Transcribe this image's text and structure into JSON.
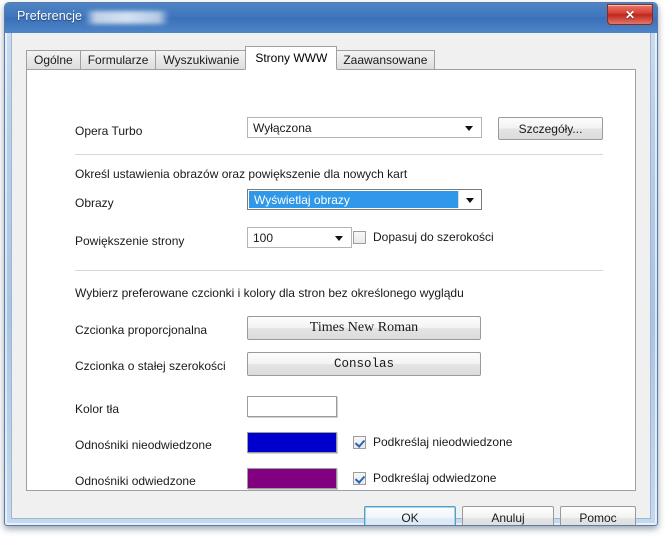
{
  "window": {
    "title": "Preferencje",
    "close_label": "✕"
  },
  "tabs": [
    {
      "label": "Ogólne",
      "active": false
    },
    {
      "label": "Formularze",
      "active": false
    },
    {
      "label": "Wyszukiwanie",
      "active": false
    },
    {
      "label": "Strony WWW",
      "active": true
    },
    {
      "label": "Zaawansowane",
      "active": false
    }
  ],
  "panel": {
    "opera_turbo": {
      "label": "Opera Turbo",
      "value": "Wyłączona",
      "details_button": "Szczegóły..."
    },
    "images_section": {
      "heading": "Określ ustawienia obrazów oraz powiększenie dla nowych kart",
      "images_label": "Obrazy",
      "images_value": "Wyświetlaj obrazy",
      "zoom_label": "Powiększenie strony",
      "zoom_value": "100",
      "fit_width_label": "Dopasuj do szerokości",
      "fit_width_checked": false
    },
    "fonts_section": {
      "heading": "Wybierz preferowane czcionki i kolory dla stron bez określonego wyglądu",
      "proportional_label": "Czcionka proporcjonalna",
      "proportional_value": "Times New Roman",
      "monospace_label": "Czcionka o stałej szerokości",
      "monospace_value": "Consolas"
    },
    "colors_section": {
      "background_label": "Kolor tła",
      "background_color": "#ffffff",
      "unvisited_label": "Odnośniki nieodwiedzone",
      "unvisited_color": "#0000cc",
      "unvisited_underline_label": "Podkreślaj nieodwiedzone",
      "unvisited_underline_checked": true,
      "visited_label": "Odnośniki odwiedzone",
      "visited_color": "#800080",
      "visited_underline_label": "Podkreślaj odwiedzone",
      "visited_underline_checked": true
    }
  },
  "footer": {
    "ok": "OK",
    "cancel": "Anuluj",
    "help": "Pomoc"
  }
}
